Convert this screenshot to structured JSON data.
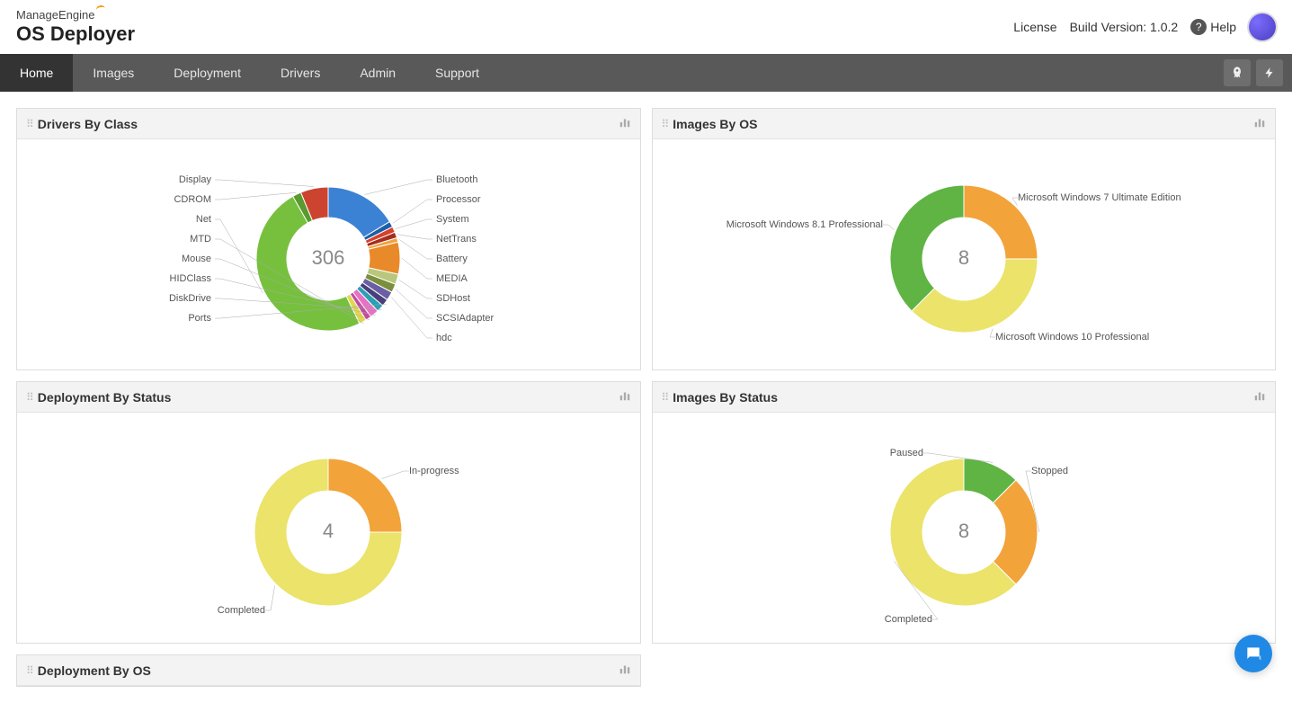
{
  "brand": {
    "top": "ManageEngine",
    "main": "OS Deployer"
  },
  "header": {
    "license": "License",
    "build": "Build Version: 1.0.2",
    "help": "Help"
  },
  "nav": {
    "items": [
      "Home",
      "Images",
      "Deployment",
      "Drivers",
      "Admin",
      "Support"
    ],
    "active_index": 0
  },
  "panels": {
    "drivers_by_class": "Drivers By Class",
    "images_by_os": "Images By OS",
    "deployment_by_status": "Deployment By Status",
    "images_by_status": "Images By Status",
    "deployment_by_os": "Deployment By OS"
  },
  "chart_data": [
    {
      "id": "drivers_by_class",
      "type": "donut",
      "title": "Drivers By Class",
      "center_value": 306,
      "series": [
        {
          "name": "Bluetooth",
          "value": 50,
          "color": "#3b82d4"
        },
        {
          "name": "Processor",
          "value": 4,
          "color": "#1e5ea8"
        },
        {
          "name": "System",
          "value": 4,
          "color": "#d7402b"
        },
        {
          "name": "NetTrans",
          "value": 4,
          "color": "#a52e1f"
        },
        {
          "name": "Battery",
          "value": 3,
          "color": "#f2a33a"
        },
        {
          "name": "MEDIA",
          "value": 22,
          "color": "#e8892a"
        },
        {
          "name": "SDHost",
          "value": 7,
          "color": "#b9c77d"
        },
        {
          "name": "SCSIAdapter",
          "value": 6,
          "color": "#7b8f3c"
        },
        {
          "name": "hdc",
          "value": 6,
          "color": "#6a5fa5"
        },
        {
          "name": "Ports",
          "value": 5,
          "color": "#4b3f7a"
        },
        {
          "name": "DiskDrive",
          "value": 5,
          "color": "#2aa0b5"
        },
        {
          "name": "HIDClass",
          "value": 6,
          "color": "#e672c1"
        },
        {
          "name": "Mouse",
          "value": 4,
          "color": "#c54a9e"
        },
        {
          "name": "MTD",
          "value": 5,
          "color": "#e0d84f"
        },
        {
          "name": "Net",
          "value": 150,
          "color": "#76c03e"
        },
        {
          "name": "CDROM",
          "value": 6,
          "color": "#5a9a2e"
        },
        {
          "name": "Display",
          "value": 19,
          "color": "#cc4430"
        }
      ],
      "left_labels": [
        "Display",
        "CDROM",
        "Net",
        "MTD",
        "Mouse",
        "HIDClass",
        "DiskDrive",
        "Ports"
      ],
      "right_labels": [
        "Bluetooth",
        "Processor",
        "System",
        "NetTrans",
        "Battery",
        "MEDIA",
        "SDHost",
        "SCSIAdapter",
        "hdc"
      ]
    },
    {
      "id": "images_by_os",
      "type": "donut",
      "title": "Images By OS",
      "center_value": 8,
      "series": [
        {
          "name": "Microsoft Windows 7 Ultimate Edition",
          "value": 2,
          "color": "#f2a33a"
        },
        {
          "name": "Microsoft Windows 10 Professional",
          "value": 3,
          "color": "#ebe36a"
        },
        {
          "name": "Microsoft Windows 8.1 Professional",
          "value": 3,
          "color": "#5fb444"
        }
      ],
      "label_positions": [
        {
          "name": "Microsoft Windows 7 Ultimate Edition",
          "x": 405,
          "y": 60,
          "anchor": "start"
        },
        {
          "name": "Microsoft Windows 10 Professional",
          "x": 380,
          "y": 215,
          "anchor": "start"
        },
        {
          "name": "Microsoft Windows 8.1 Professional",
          "x": 255,
          "y": 90,
          "anchor": "end"
        }
      ]
    },
    {
      "id": "deployment_by_status",
      "type": "donut",
      "title": "Deployment By Status",
      "center_value": 4,
      "series": [
        {
          "name": "In-progress",
          "value": 1,
          "color": "#f2a33a"
        },
        {
          "name": "Completed",
          "value": 3,
          "color": "#ebe36a"
        }
      ],
      "label_positions": [
        {
          "name": "In-progress",
          "x": 435,
          "y": 60,
          "anchor": "start"
        },
        {
          "name": "Completed",
          "x": 275,
          "y": 215,
          "anchor": "end"
        }
      ]
    },
    {
      "id": "images_by_status",
      "type": "donut",
      "title": "Images By Status",
      "center_value": 8,
      "series": [
        {
          "name": "Paused",
          "value": 1,
          "color": "#5fb444"
        },
        {
          "name": "Stopped",
          "value": 2,
          "color": "#f2a33a"
        },
        {
          "name": "Completed",
          "value": 5,
          "color": "#ebe36a"
        }
      ],
      "label_positions": [
        {
          "name": "Paused",
          "x": 300,
          "y": 40,
          "anchor": "end"
        },
        {
          "name": "Stopped",
          "x": 420,
          "y": 60,
          "anchor": "start"
        },
        {
          "name": "Completed",
          "x": 310,
          "y": 225,
          "anchor": "end"
        }
      ]
    }
  ]
}
